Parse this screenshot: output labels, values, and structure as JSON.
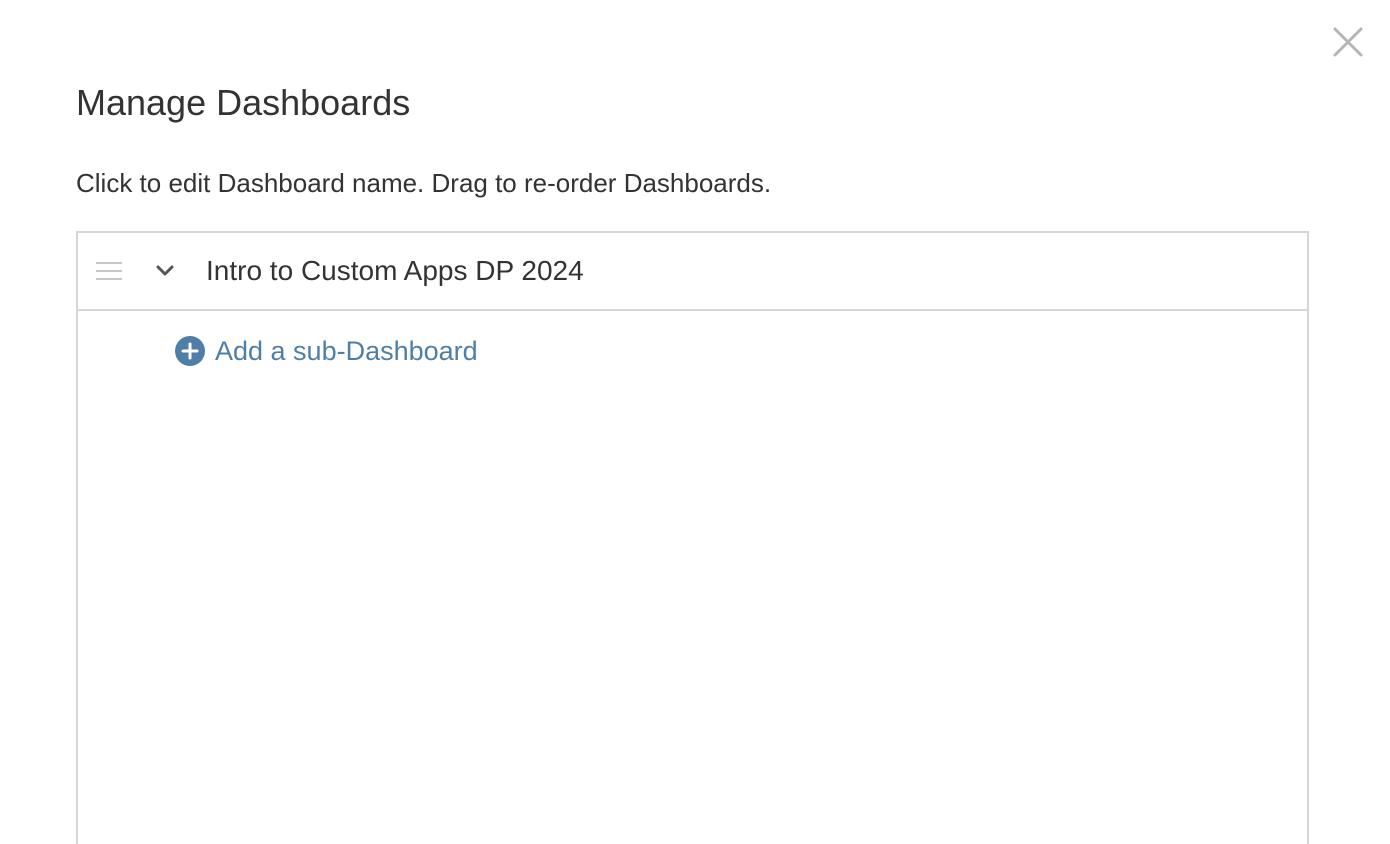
{
  "dialog": {
    "title": "Manage Dashboards",
    "instructions": "Click to edit Dashboard name. Drag to re-order Dashboards.",
    "close_icon": "close-icon"
  },
  "dashboards": [
    {
      "name": "Intro to Custom Apps DP 2024",
      "expanded": true,
      "drag_icon": "drag-handle-icon",
      "toggle_icon": "chevron-down-icon",
      "add_sub_label": "Add a sub-Dashboard",
      "add_sub_icon": "plus-circle-icon"
    }
  ],
  "colors": {
    "accent": "#4f7ea6",
    "border": "#d6d6d6",
    "text": "#333333",
    "muted_icon": "#c8c8c8"
  }
}
